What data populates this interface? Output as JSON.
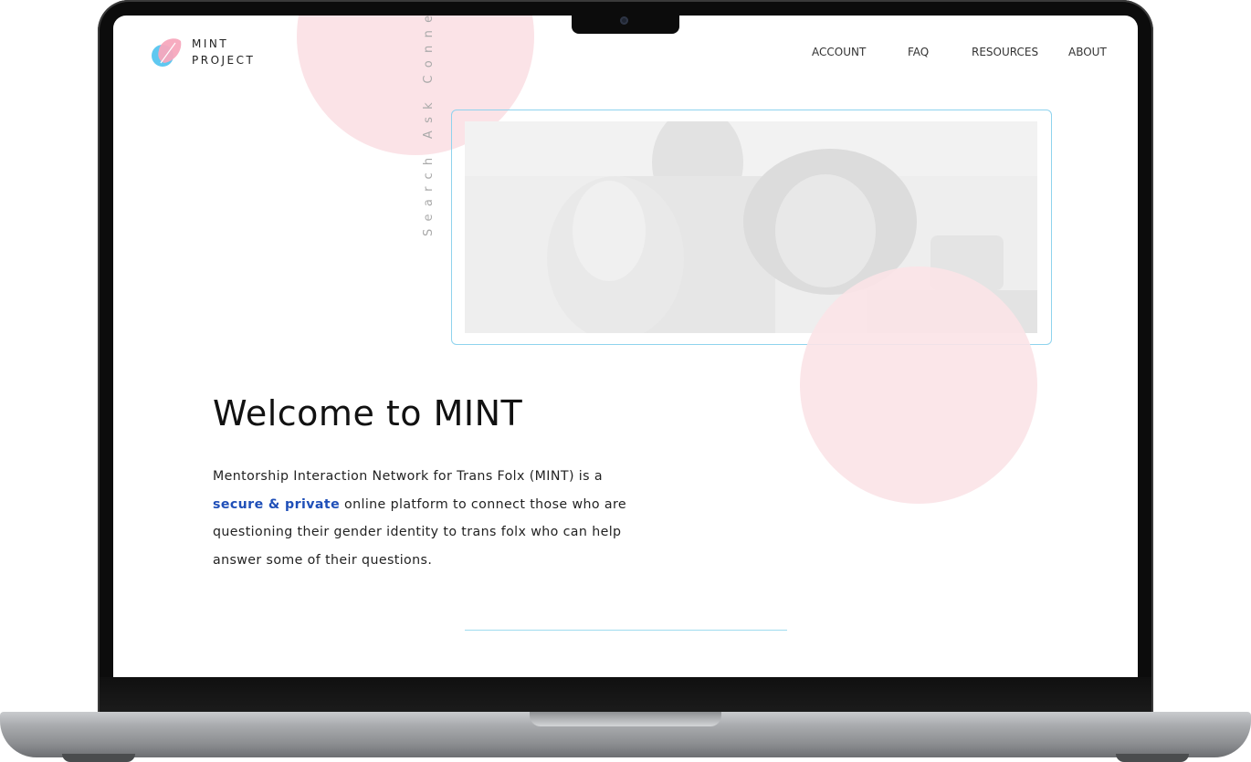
{
  "brand": {
    "name_line1": "MINT",
    "name_line2": "PROJECT",
    "logo_icon": "pink-blue-leaf-icon",
    "colors": {
      "pink": "#f7a8bd",
      "blue": "#5fc8f0"
    }
  },
  "nav": {
    "items": [
      {
        "label": "ACCOUNT"
      },
      {
        "label": "FAQ"
      },
      {
        "label": "RESOURCES"
      },
      {
        "label": "ABOUT"
      }
    ]
  },
  "hero": {
    "tagline": "Search Ask Connect",
    "title": "Welcome to MINT",
    "copy_before": "Mentorship Interaction Network for Trans Folx (MINT) is a ",
    "copy_highlight": "secure & private",
    "copy_after": " online platform to connect those who are questioning their gender identity to trans folx who can help answer some of their questions."
  },
  "colors": {
    "accent_blue": "#1f4fb8",
    "blob_pink": "#fbe3e7",
    "frame_cyan": "#8fd3ee"
  }
}
